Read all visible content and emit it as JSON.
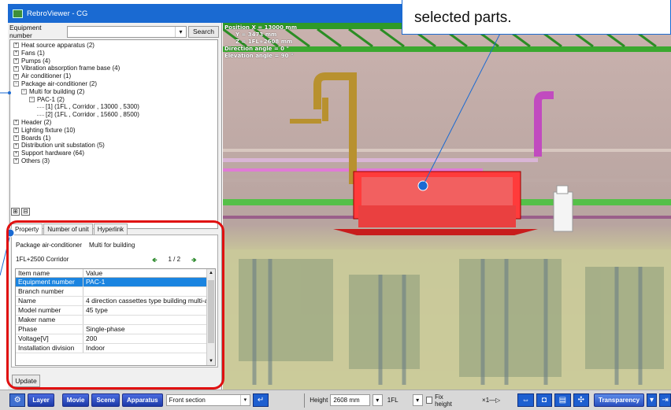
{
  "window": {
    "title": "RebroViewer - CG"
  },
  "callout": {
    "text": "selected parts."
  },
  "search": {
    "label": "Equipment number",
    "value": "",
    "button": "Search"
  },
  "tree": [
    {
      "label": "Heat source apparatus (2)",
      "level": 0,
      "toggle": "+"
    },
    {
      "label": "Fans (1)",
      "level": 0,
      "toggle": "+"
    },
    {
      "label": "Pumps (4)",
      "level": 0,
      "toggle": "+"
    },
    {
      "label": "Vibration absorption frame base (4)",
      "level": 0,
      "toggle": "+"
    },
    {
      "label": "Air conditioner (1)",
      "level": 0,
      "toggle": "+"
    },
    {
      "label": "Package air-conditioner (2)",
      "level": 0,
      "toggle": "−"
    },
    {
      "label": "Multi for building (2)",
      "level": 1,
      "toggle": "−"
    },
    {
      "label": "PAC-1 (2)",
      "level": 2,
      "toggle": "−"
    },
    {
      "label": "[1] (1FL , Corridor , 13000 , 5300)",
      "level": 3,
      "toggle": ""
    },
    {
      "label": "[2] (1FL , Corridor , 15600 , 8500)",
      "level": 3,
      "toggle": ""
    },
    {
      "label": "Header (2)",
      "level": 0,
      "toggle": "+"
    },
    {
      "label": "Lighting fixture (10)",
      "level": 0,
      "toggle": "+"
    },
    {
      "label": "Boards (1)",
      "level": 0,
      "toggle": "+"
    },
    {
      "label": "Distribution unit substation (5)",
      "level": 0,
      "toggle": "+"
    },
    {
      "label": "Support hardware (64)",
      "level": 0,
      "toggle": "+"
    },
    {
      "label": "Others (3)",
      "level": 0,
      "toggle": "+"
    }
  ],
  "tree_buttons": {
    "expand": "⊞",
    "collapse": "⊟"
  },
  "tabs": [
    "Property",
    "Number of unit",
    "Hyperlink"
  ],
  "property": {
    "category": "Package air-conditioner",
    "subcategory": "Multi for building",
    "location": "1FL+2500 Corridor",
    "page": "1 / 2",
    "prev": "🡸",
    "next": "🡺",
    "col_item": "Item name",
    "col_value": "Value",
    "rows": [
      {
        "name": "Equipment number",
        "value": "PAC-1",
        "selected": true
      },
      {
        "name": "  Branch number",
        "value": ""
      },
      {
        "name": "Name",
        "value": "4 direction cassettes type building multi-a..."
      },
      {
        "name": "Model number",
        "value": "45 type"
      },
      {
        "name": "Maker name",
        "value": ""
      },
      {
        "name": "Phase",
        "value": "Single-phase"
      },
      {
        "name": "Voltage[V]",
        "value": "200"
      },
      {
        "name": "Installation division",
        "value": "Indoor"
      }
    ],
    "update": "Update"
  },
  "hud": {
    "x": "Position X = 13000 mm",
    "y": "Y = 3473 mm",
    "z": "Z = 1FL+2608 mm",
    "dir": "Direction angle = 0 °",
    "elev": "Elevation angle = 90 °"
  },
  "toolbar": {
    "layer": "Layer",
    "movie": "Movie",
    "scene": "Scene",
    "apparatus": "Apparatus",
    "section": "Front section",
    "height_label": "Height",
    "height_value": "2608 mm",
    "floor": "1FL",
    "fix": "Fix height",
    "transparency": "Transparency",
    "scale": "×1"
  }
}
